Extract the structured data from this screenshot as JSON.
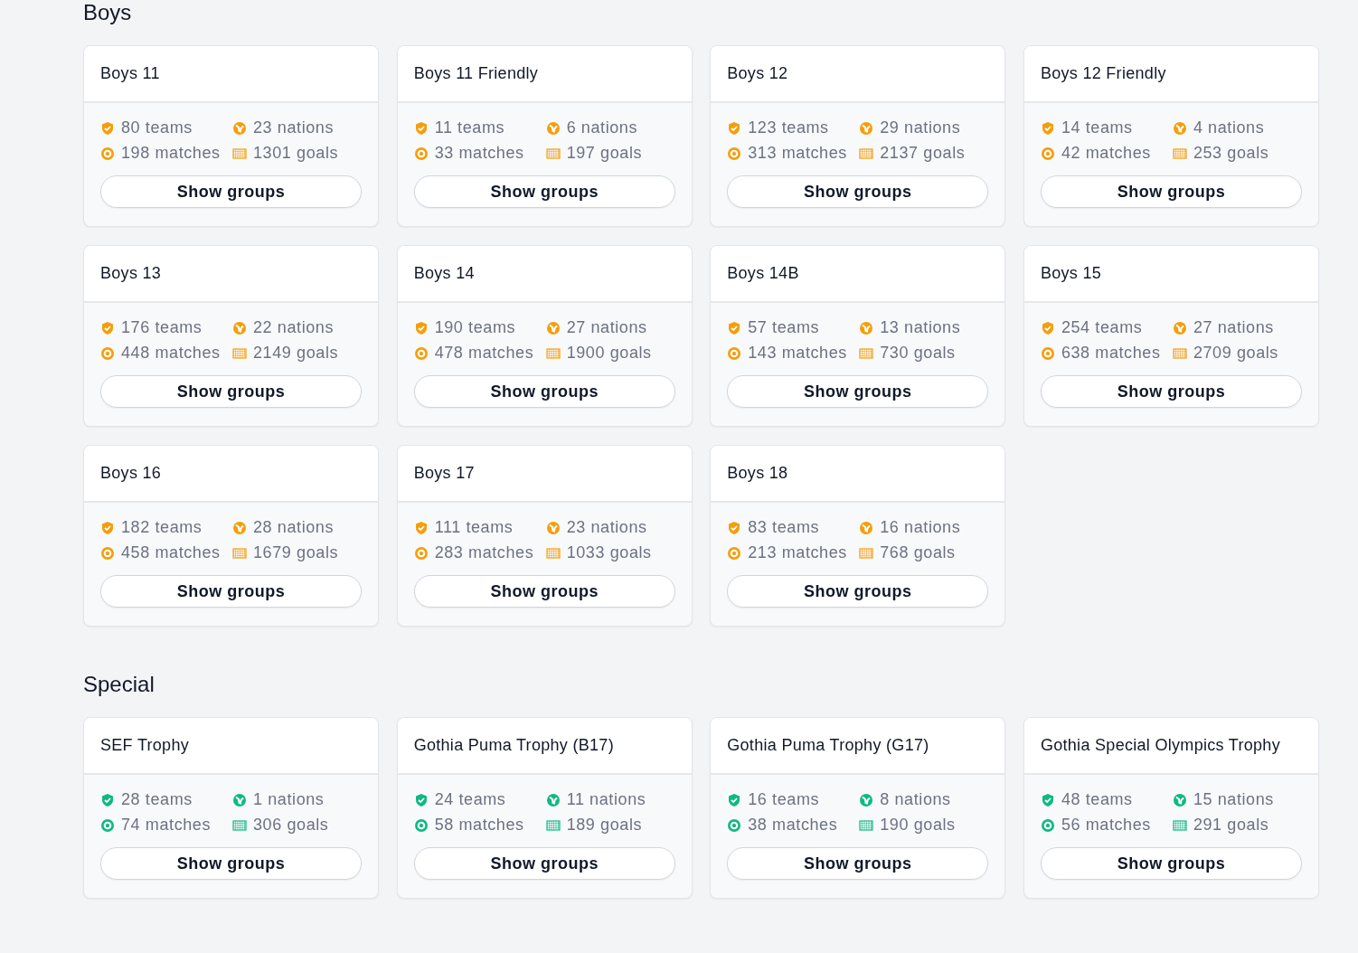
{
  "sections": [
    {
      "title": "Boys",
      "color": "#f59e0b",
      "cards": [
        {
          "title": "Boys 11",
          "teams": "80 teams",
          "nations": "23 nations",
          "matches": "198 matches",
          "goals": "1301 goals",
          "button": "Show groups"
        },
        {
          "title": "Boys 11 Friendly",
          "teams": "11 teams",
          "nations": "6 nations",
          "matches": "33 matches",
          "goals": "197 goals",
          "button": "Show groups"
        },
        {
          "title": "Boys 12",
          "teams": "123 teams",
          "nations": "29 nations",
          "matches": "313 matches",
          "goals": "2137 goals",
          "button": "Show groups"
        },
        {
          "title": "Boys 12 Friendly",
          "teams": "14 teams",
          "nations": "4 nations",
          "matches": "42 matches",
          "goals": "253 goals",
          "button": "Show groups"
        },
        {
          "title": "Boys 13",
          "teams": "176 teams",
          "nations": "22 nations",
          "matches": "448 matches",
          "goals": "2149 goals",
          "button": "Show groups"
        },
        {
          "title": "Boys 14",
          "teams": "190 teams",
          "nations": "27 nations",
          "matches": "478 matches",
          "goals": "1900 goals",
          "button": "Show groups"
        },
        {
          "title": "Boys 14B",
          "teams": "57 teams",
          "nations": "13 nations",
          "matches": "143 matches",
          "goals": "730 goals",
          "button": "Show groups"
        },
        {
          "title": "Boys 15",
          "teams": "254 teams",
          "nations": "27 nations",
          "matches": "638 matches",
          "goals": "2709 goals",
          "button": "Show groups"
        },
        {
          "title": "Boys 16",
          "teams": "182 teams",
          "nations": "28 nations",
          "matches": "458 matches",
          "goals": "1679 goals",
          "button": "Show groups"
        },
        {
          "title": "Boys 17",
          "teams": "111 teams",
          "nations": "23 nations",
          "matches": "283 matches",
          "goals": "1033 goals",
          "button": "Show groups"
        },
        {
          "title": "Boys 18",
          "teams": "83 teams",
          "nations": "16 nations",
          "matches": "213 matches",
          "goals": "768 goals",
          "button": "Show groups"
        }
      ]
    },
    {
      "title": "Special",
      "color": "#10b981",
      "cards": [
        {
          "title": "SEF Trophy",
          "teams": "28 teams",
          "nations": "1 nations",
          "matches": "74 matches",
          "goals": "306 goals",
          "button": "Show groups"
        },
        {
          "title": "Gothia Puma Trophy (B17)",
          "teams": "24 teams",
          "nations": "11 nations",
          "matches": "58 matches",
          "goals": "189 goals",
          "button": "Show groups"
        },
        {
          "title": "Gothia Puma Trophy (G17)",
          "teams": "16 teams",
          "nations": "8 nations",
          "matches": "38 matches",
          "goals": "190 goals",
          "button": "Show groups"
        },
        {
          "title": "Gothia Special Olympics Trophy",
          "teams": "48 teams",
          "nations": "15 nations",
          "matches": "56 matches",
          "goals": "291 goals",
          "button": "Show groups"
        }
      ]
    }
  ]
}
